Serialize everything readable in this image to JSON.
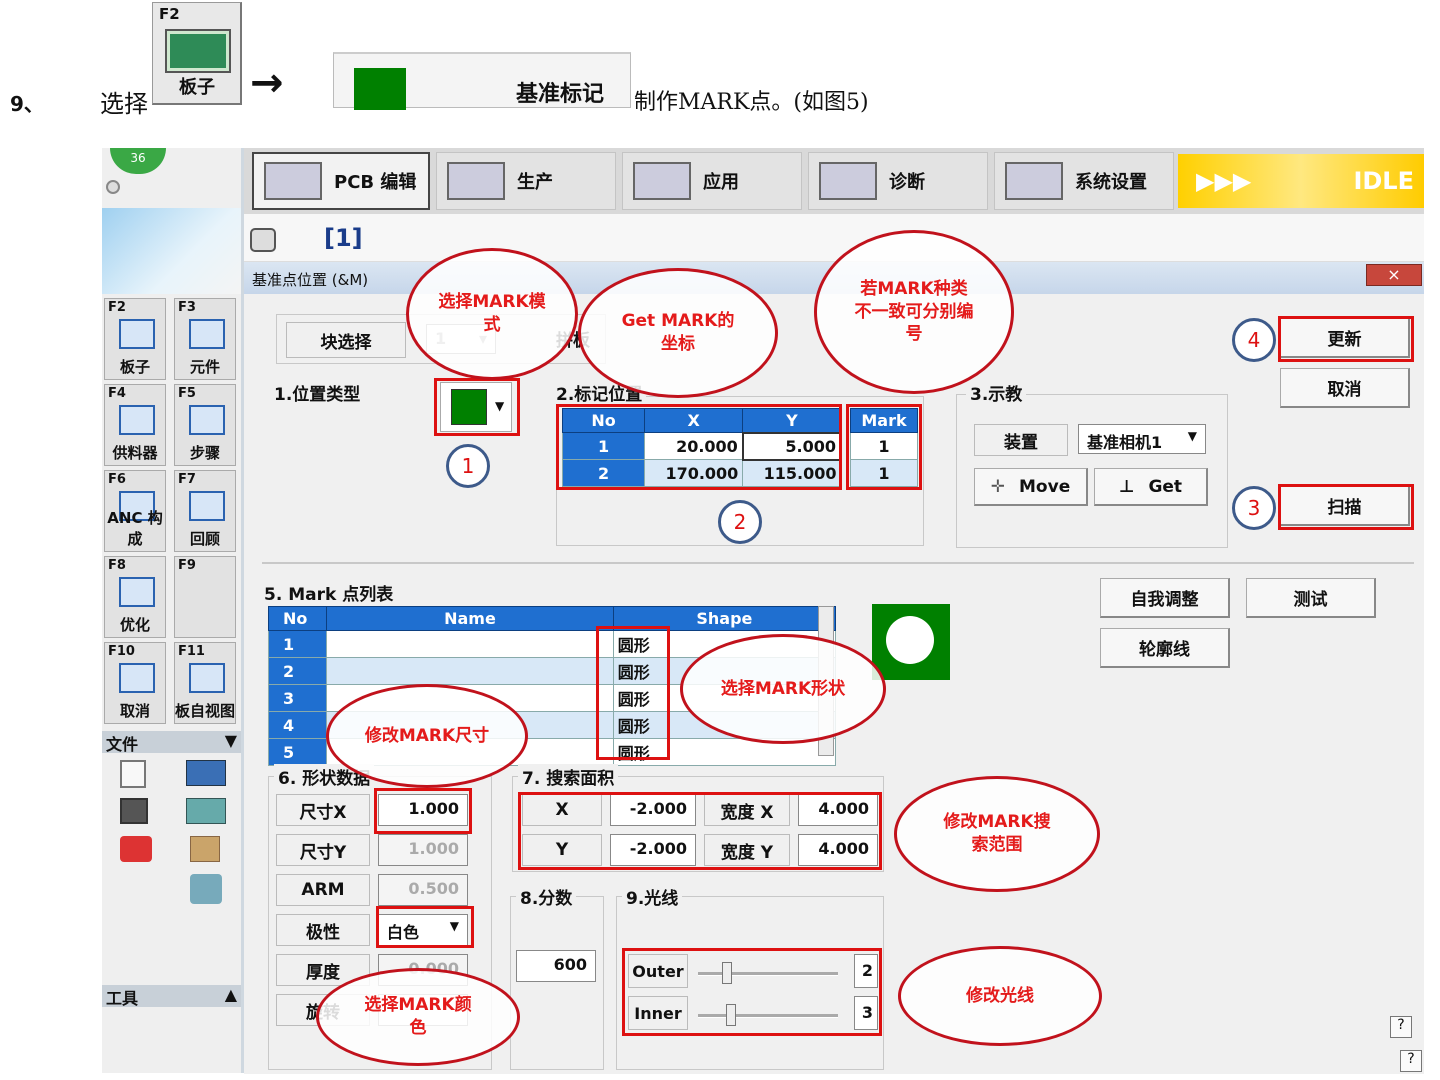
{
  "instruction": {
    "step_number": "9、",
    "prefix": "选择",
    "f2_key": "F2",
    "f2_label": "板子",
    "arrow": "→",
    "fiducial_button_label": "基准标记",
    "suffix": "制作MARK点。(如图5)"
  },
  "left_panel": {
    "badge": "36",
    "tiles": [
      {
        "key": "F2",
        "label": "板子"
      },
      {
        "key": "F3",
        "label": "元件"
      },
      {
        "key": "F4",
        "label": "供料器"
      },
      {
        "key": "F5",
        "label": "步骤"
      },
      {
        "key": "F6",
        "label": "ANC 构成"
      },
      {
        "key": "F7",
        "label": "回顾"
      },
      {
        "key": "F8",
        "label": "优化"
      },
      {
        "key": "F9",
        "label": ""
      },
      {
        "key": "F10",
        "label": "取消"
      },
      {
        "key": "F11",
        "label": "板自视图"
      }
    ],
    "file_section": "文件",
    "tools_section": "工具"
  },
  "tabs": [
    {
      "label": "PCB 编辑",
      "icon": "pcb-edit-icon"
    },
    {
      "label": "生产",
      "icon": "production-icon"
    },
    {
      "label": "应用",
      "icon": "application-icon"
    },
    {
      "label": "诊断",
      "icon": "diagnosis-icon"
    },
    {
      "label": "系统设置",
      "icon": "system-settings-icon"
    }
  ],
  "status": {
    "arrows": "▶▶▶",
    "text": "IDLE"
  },
  "board_index": "[1]",
  "dialog": {
    "title": "基准点位置 (&M)",
    "block_select_label": "块选择",
    "block_select_value": "1",
    "board_label": "拼板",
    "position_type_label": "1.位置类型",
    "mark_position_label": "2.标记位置",
    "teach_label": "3.示教",
    "device_label": "装置",
    "device_value": "基准相机1",
    "move_label": "Move",
    "get_label": "Get",
    "update_button": "更新",
    "cancel_button": "取消",
    "scan_button": "扫描",
    "self_adjust_button": "自我调整",
    "test_button": "测试",
    "contour_button": "轮廓线",
    "mark_table": {
      "headers": [
        "No",
        "X",
        "Y",
        "Mark"
      ],
      "rows": [
        {
          "no": "1",
          "x": "20.000",
          "y": "5.000",
          "mark": "1"
        },
        {
          "no": "2",
          "x": "170.000",
          "y": "115.000",
          "mark": "1"
        }
      ]
    },
    "mark_list_label": "5. Mark 点列表",
    "mark_list": {
      "headers": [
        "No",
        "Name",
        "Shape"
      ],
      "rows": [
        {
          "no": "1",
          "name": "",
          "shape": "圆形"
        },
        {
          "no": "2",
          "name": "",
          "shape": "圆形"
        },
        {
          "no": "3",
          "name": "",
          "shape": "圆形"
        },
        {
          "no": "4",
          "name": "",
          "shape": "圆形"
        },
        {
          "no": "5",
          "name": "",
          "shape": "圆形"
        }
      ]
    },
    "shape_data_label": "6. 形状数据",
    "size_x_label": "尺寸X",
    "size_x_value": "1.000",
    "size_y_label": "尺寸Y",
    "size_y_value": "1.000",
    "arm_label": "ARM",
    "arm_value": "0.500",
    "polarity_label": "极性",
    "polarity_value": "白色",
    "thickness_label": "厚度",
    "thickness_value": "0.000",
    "rotation_label": "旋转",
    "search_area_label": "7. 搜索面积",
    "search_x_label": "X",
    "search_x_value": "-2.000",
    "width_x_label": "宽度 X",
    "width_x_value": "4.000",
    "search_y_label": "Y",
    "search_y_value": "-2.000",
    "width_y_label": "宽度 Y",
    "width_y_value": "4.000",
    "score_label": "8.分数",
    "score_value": "600",
    "light_label": "9.光线",
    "outer_label": "Outer",
    "outer_value": "2",
    "inner_label": "Inner",
    "inner_value": "3",
    "help": "?"
  },
  "annotations": {
    "select_mark_mode": "选择MARK模式",
    "get_mark_coords": "Get MARK的坐标",
    "mark_type_numbering": "若MARK种类不一致可分别编号",
    "select_mark_shape": "选择MARK形状",
    "modify_mark_size": "修改MARK尺寸",
    "modify_search_range": "修改MARK搜索范围",
    "modify_light": "修改光线",
    "select_mark_color": "选择MARK颜色",
    "num1": "1",
    "num2": "2",
    "num3": "3",
    "num4": "4"
  },
  "colors": {
    "grid_header": "#1f6fd0",
    "fiducial_green": "#008000",
    "annotation_red": "#d11111",
    "idle_yellow": "#ffd000"
  }
}
